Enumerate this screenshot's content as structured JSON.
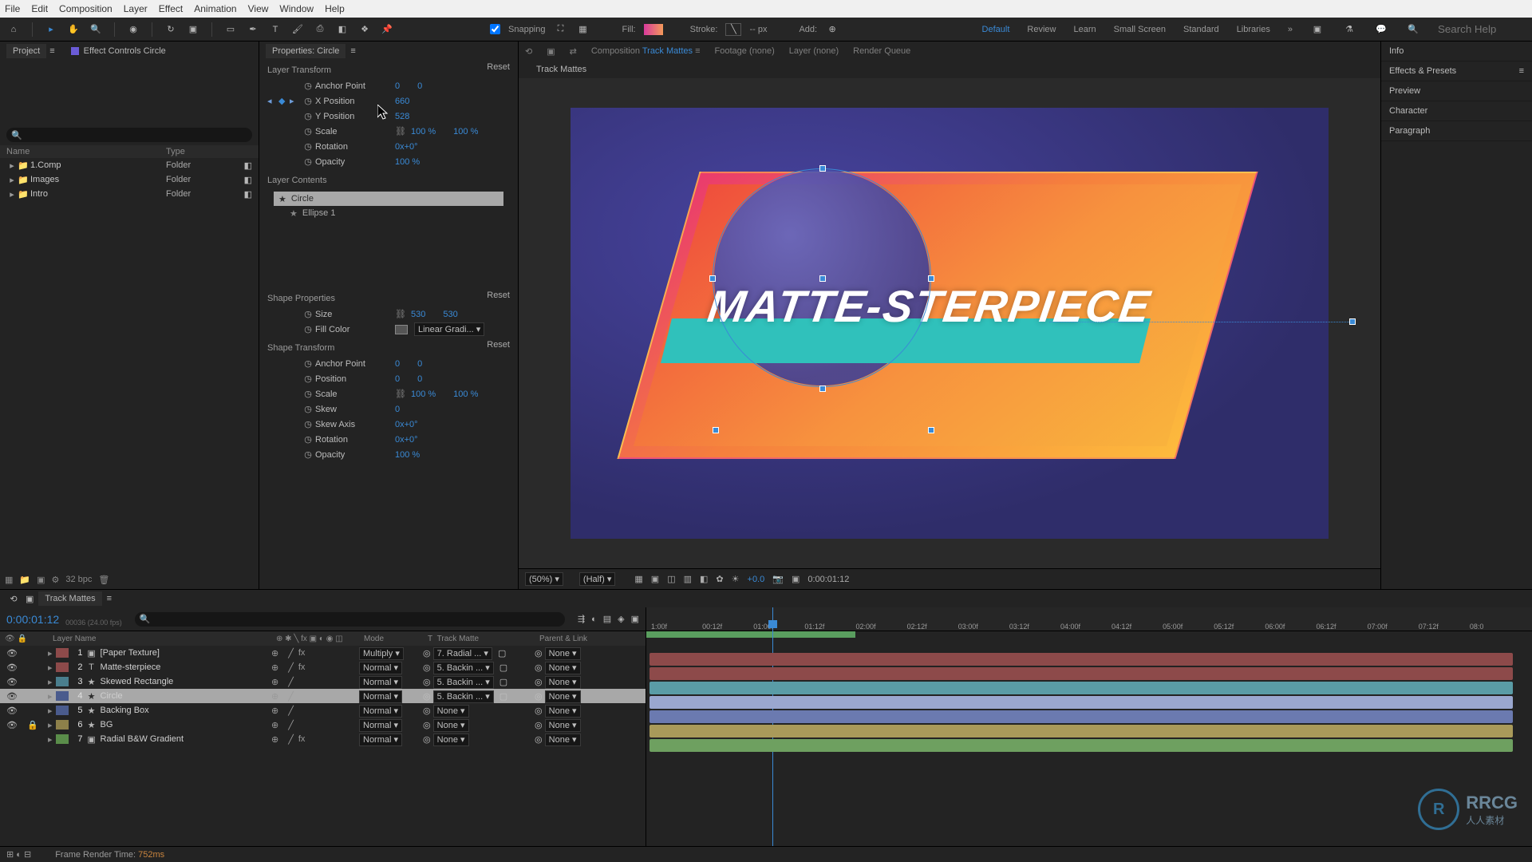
{
  "menu": [
    "File",
    "Edit",
    "Composition",
    "Layer",
    "Effect",
    "Animation",
    "View",
    "Window",
    "Help"
  ],
  "toolbar": {
    "snapping": "Snapping",
    "fill": "Fill:",
    "stroke": "Stroke:",
    "stroke_px": "-- px",
    "add": "Add:",
    "modes": [
      "Default",
      "Review",
      "Learn",
      "Small Screen",
      "Standard",
      "Libraries"
    ],
    "search_ph": "Search Help"
  },
  "project": {
    "tab": "Project",
    "effect_tab": "Effect Controls Circle",
    "head_name": "Name",
    "head_type": "Type",
    "rows": [
      {
        "name": "1.Comp",
        "type": "Folder"
      },
      {
        "name": "Images",
        "type": "Folder"
      },
      {
        "name": "Intro",
        "type": "Folder"
      }
    ],
    "footer_bpc": "32 bpc"
  },
  "props": {
    "header": "Properties: Circle",
    "layer_transform": {
      "title": "Layer Transform",
      "reset": "Reset",
      "rows": [
        {
          "name": "Anchor Point",
          "v1": "0",
          "v2": "0"
        },
        {
          "name": "X Position",
          "v1": "660",
          "keyed": true
        },
        {
          "name": "Y Position",
          "v1": "528"
        },
        {
          "name": "Scale",
          "v1": "100 %",
          "v2": "100 %",
          "link": true
        },
        {
          "name": "Rotation",
          "v1": "0x+0°"
        },
        {
          "name": "Opacity",
          "v1": "100 %"
        }
      ]
    },
    "layer_contents": {
      "title": "Layer Contents",
      "rows": [
        "Circle",
        "Ellipse 1"
      ]
    },
    "shape_props": {
      "title": "Shape Properties",
      "reset": "Reset",
      "rows": [
        {
          "name": "Size",
          "v1": "530",
          "v2": "530",
          "link": true
        },
        {
          "name": "Fill Color",
          "fill": "Linear Gradi..."
        }
      ]
    },
    "shape_transform": {
      "title": "Shape Transform",
      "reset": "Reset",
      "rows": [
        {
          "name": "Anchor Point",
          "v1": "0",
          "v2": "0"
        },
        {
          "name": "Position",
          "v1": "0",
          "v2": "0"
        },
        {
          "name": "Scale",
          "v1": "100 %",
          "v2": "100 %",
          "link": true
        },
        {
          "name": "Skew",
          "v1": "0"
        },
        {
          "name": "Skew Axis",
          "v1": "0x+0°"
        },
        {
          "name": "Rotation",
          "v1": "0x+0°"
        },
        {
          "name": "Opacity",
          "v1": "100 %"
        }
      ]
    }
  },
  "comp": {
    "comp_label": "Composition",
    "comp_name": "Track Mattes",
    "footage": "Footage",
    "footage_val": "(none)",
    "layer": "Layer",
    "layer_val": "(none)",
    "rq": "Render Queue",
    "active_tab": "Track Mattes",
    "hero": "MATTE-STERPIECE",
    "zoom": "(50%)",
    "res": "(Half)",
    "time": "0:00:01:12",
    "exp": "+0.0"
  },
  "right": [
    "Info",
    "Effects & Presets",
    "Preview",
    "Character",
    "Paragraph"
  ],
  "timeline": {
    "tab": "Track Mattes",
    "time": "0:00:01:12",
    "sub": "00036 (24.00 fps)",
    "cols": {
      "layer": "Layer Name",
      "mode": "Mode",
      "t": "T",
      "tm": "Track Matte",
      "parent": "Parent & Link"
    },
    "layers": [
      {
        "idx": "1",
        "name": "[Paper Texture]",
        "swatch": "swatch-red",
        "mode": "Multiply",
        "tm": "7. Radial ...",
        "parent": "None",
        "fx": true
      },
      {
        "idx": "2",
        "name": "Matte-sterpiece",
        "swatch": "swatch-red",
        "mode": "Normal",
        "tm": "5. Backin ...",
        "parent": "None",
        "fx": true,
        "txt": true
      },
      {
        "idx": "3",
        "name": "Skewed Rectangle",
        "swatch": "swatch-cyan",
        "mode": "Normal",
        "tm": "5. Backin ...",
        "parent": "None",
        "shape": true
      },
      {
        "idx": "4",
        "name": "Circle",
        "swatch": "swatch-blue",
        "mode": "Normal",
        "tm": "5. Backin ...",
        "parent": "None",
        "shape": true,
        "sel": true
      },
      {
        "idx": "5",
        "name": "Backing Box",
        "swatch": "swatch-blue",
        "mode": "Normal",
        "tm": "None",
        "parent": "None",
        "shape": true
      },
      {
        "idx": "6",
        "name": "BG",
        "swatch": "swatch-sand",
        "mode": "Normal",
        "tm": "None",
        "parent": "None",
        "shape": true,
        "locked": true
      },
      {
        "idx": "7",
        "name": "Radial B&W Gradient",
        "swatch": "swatch-green",
        "mode": "Normal",
        "tm": "None",
        "parent": "None",
        "fx": true,
        "hidden": true
      }
    ],
    "ticks": [
      "1:00f",
      "00:12f",
      "01:00f",
      "01:12f",
      "02:00f",
      "02:12f",
      "03:00f",
      "03:12f",
      "04:00f",
      "04:12f",
      "05:00f",
      "05:12f",
      "06:00f",
      "06:12f",
      "07:00f",
      "07:12f",
      "08:0"
    ],
    "bars": [
      {
        "i": 0,
        "color": "#8d4a4a"
      },
      {
        "i": 1,
        "color": "#8d4a4a"
      },
      {
        "i": 2,
        "color": "#5a9ca6"
      },
      {
        "i": 3,
        "color": "#6b7ab0",
        "sel": true
      },
      {
        "i": 4,
        "color": "#6b7ab0"
      },
      {
        "i": 5,
        "color": "#a99a5a"
      },
      {
        "i": 6,
        "color": "#6ea060"
      }
    ],
    "workarea_end_pct": 24,
    "playhead_pct": 14.5,
    "render_label": "Frame Render Time:",
    "render_time": "752ms"
  },
  "watermark": {
    "brand": "RRCG",
    "sub": "人人素材"
  }
}
